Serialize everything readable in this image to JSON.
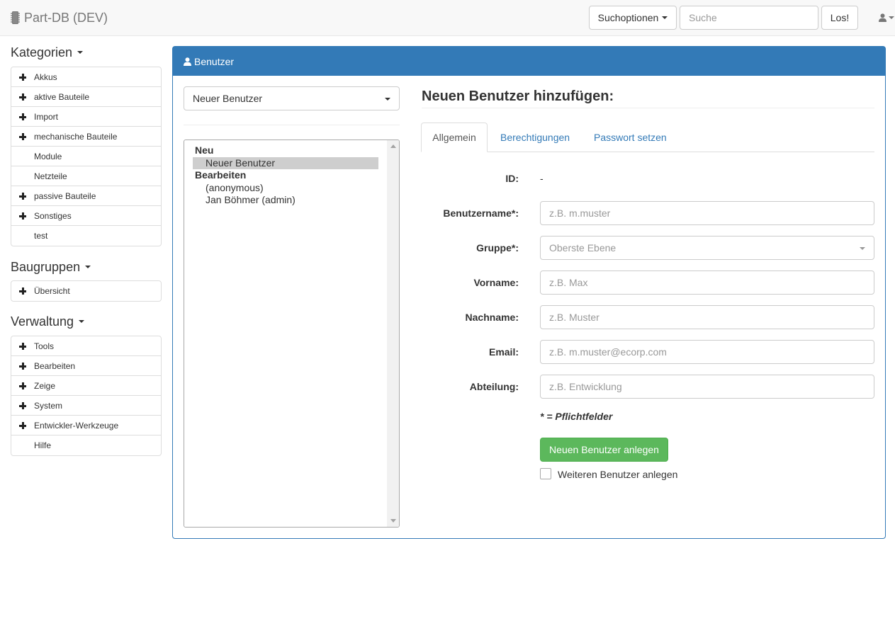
{
  "navbar": {
    "brand": "Part-DB (DEV)",
    "search_options_label": "Suchoptionen",
    "search_placeholder": "Suche",
    "go_label": "Los!"
  },
  "sidebar": {
    "kategorien": {
      "title": "Kategorien",
      "items": [
        {
          "label": "Akkus",
          "expandable": true
        },
        {
          "label": "aktive Bauteile",
          "expandable": true
        },
        {
          "label": "Import",
          "expandable": true
        },
        {
          "label": "mechanische Bauteile",
          "expandable": true
        },
        {
          "label": "Module",
          "expandable": false
        },
        {
          "label": "Netzteile",
          "expandable": false
        },
        {
          "label": "passive Bauteile",
          "expandable": true
        },
        {
          "label": "Sonstiges",
          "expandable": true
        },
        {
          "label": "test",
          "expandable": false
        }
      ]
    },
    "baugruppen": {
      "title": "Baugruppen",
      "items": [
        {
          "label": "Übersicht",
          "expandable": true
        }
      ]
    },
    "verwaltung": {
      "title": "Verwaltung",
      "items": [
        {
          "label": "Tools",
          "expandable": true
        },
        {
          "label": "Bearbeiten",
          "expandable": true
        },
        {
          "label": "Zeige",
          "expandable": true
        },
        {
          "label": "System",
          "expandable": true
        },
        {
          "label": "Entwickler-Werkzeuge",
          "expandable": true
        },
        {
          "label": "Hilfe",
          "expandable": false
        }
      ]
    }
  },
  "panel": {
    "heading": "Benutzer",
    "user_select_value": "Neuer Benutzer",
    "user_list": {
      "group_new": "Neu",
      "new_user": "Neuer Benutzer",
      "group_edit": "Bearbeiten",
      "users": [
        "(anonymous)",
        "Jan Böhmer (admin)"
      ]
    }
  },
  "form": {
    "title": "Neuen Benutzer hinzufügen:",
    "tabs": [
      "Allgemein",
      "Berechtigungen",
      "Passwort setzen"
    ],
    "id_label": "ID:",
    "id_value": "-",
    "username_label": "Benutzername*:",
    "username_placeholder": "z.B. m.muster",
    "group_label": "Gruppe*:",
    "group_value": "Oberste Ebene",
    "firstname_label": "Vorname:",
    "firstname_placeholder": "z.B. Max",
    "lastname_label": "Nachname:",
    "lastname_placeholder": "z.B. Muster",
    "email_label": "Email:",
    "email_placeholder": "z.B. m.muster@ecorp.com",
    "department_label": "Abteilung:",
    "department_placeholder": "z.B. Entwicklung",
    "required_note": "* = Pflichtfelder",
    "submit_label": "Neuen Benutzer anlegen",
    "another_user_label": "Weiteren Benutzer anlegen",
    "another_user_checked": false
  },
  "colors": {
    "primary": "#337ab7",
    "success": "#5cb85c",
    "navbar_bg": "#f8f8f8",
    "selected_option": "#cecece"
  }
}
